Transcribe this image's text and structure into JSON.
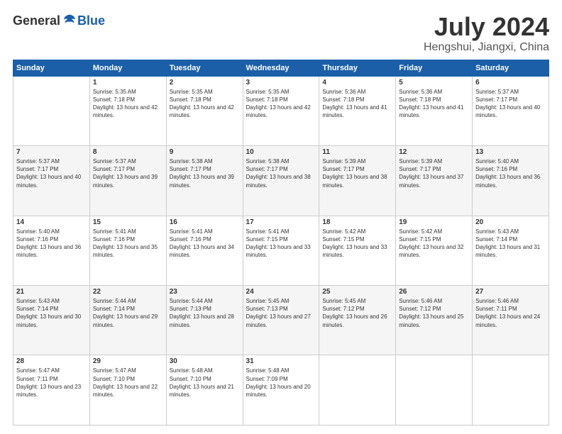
{
  "logo": {
    "general": "General",
    "blue": "Blue"
  },
  "header": {
    "title": "July 2024",
    "subtitle": "Hengshui, Jiangxi, China"
  },
  "weekdays": [
    "Sunday",
    "Monday",
    "Tuesday",
    "Wednesday",
    "Thursday",
    "Friday",
    "Saturday"
  ],
  "weeks": [
    [
      {
        "day": "",
        "sunrise": "",
        "sunset": "",
        "daylight": ""
      },
      {
        "day": "1",
        "sunrise": "Sunrise: 5:35 AM",
        "sunset": "Sunset: 7:18 PM",
        "daylight": "Daylight: 13 hours and 42 minutes."
      },
      {
        "day": "2",
        "sunrise": "Sunrise: 5:35 AM",
        "sunset": "Sunset: 7:18 PM",
        "daylight": "Daylight: 13 hours and 42 minutes."
      },
      {
        "day": "3",
        "sunrise": "Sunrise: 5:35 AM",
        "sunset": "Sunset: 7:18 PM",
        "daylight": "Daylight: 13 hours and 42 minutes."
      },
      {
        "day": "4",
        "sunrise": "Sunrise: 5:36 AM",
        "sunset": "Sunset: 7:18 PM",
        "daylight": "Daylight: 13 hours and 41 minutes."
      },
      {
        "day": "5",
        "sunrise": "Sunrise: 5:36 AM",
        "sunset": "Sunset: 7:18 PM",
        "daylight": "Daylight: 13 hours and 41 minutes."
      },
      {
        "day": "6",
        "sunrise": "Sunrise: 5:37 AM",
        "sunset": "Sunset: 7:17 PM",
        "daylight": "Daylight: 13 hours and 40 minutes."
      }
    ],
    [
      {
        "day": "7",
        "sunrise": "Sunrise: 5:37 AM",
        "sunset": "Sunset: 7:17 PM",
        "daylight": "Daylight: 13 hours and 40 minutes."
      },
      {
        "day": "8",
        "sunrise": "Sunrise: 5:37 AM",
        "sunset": "Sunset: 7:17 PM",
        "daylight": "Daylight: 13 hours and 39 minutes."
      },
      {
        "day": "9",
        "sunrise": "Sunrise: 5:38 AM",
        "sunset": "Sunset: 7:17 PM",
        "daylight": "Daylight: 13 hours and 39 minutes."
      },
      {
        "day": "10",
        "sunrise": "Sunrise: 5:38 AM",
        "sunset": "Sunset: 7:17 PM",
        "daylight": "Daylight: 13 hours and 38 minutes."
      },
      {
        "day": "11",
        "sunrise": "Sunrise: 5:39 AM",
        "sunset": "Sunset: 7:17 PM",
        "daylight": "Daylight: 13 hours and 38 minutes."
      },
      {
        "day": "12",
        "sunrise": "Sunrise: 5:39 AM",
        "sunset": "Sunset: 7:17 PM",
        "daylight": "Daylight: 13 hours and 37 minutes."
      },
      {
        "day": "13",
        "sunrise": "Sunrise: 5:40 AM",
        "sunset": "Sunset: 7:16 PM",
        "daylight": "Daylight: 13 hours and 36 minutes."
      }
    ],
    [
      {
        "day": "14",
        "sunrise": "Sunrise: 5:40 AM",
        "sunset": "Sunset: 7:16 PM",
        "daylight": "Daylight: 13 hours and 36 minutes."
      },
      {
        "day": "15",
        "sunrise": "Sunrise: 5:41 AM",
        "sunset": "Sunset: 7:16 PM",
        "daylight": "Daylight: 13 hours and 35 minutes."
      },
      {
        "day": "16",
        "sunrise": "Sunrise: 5:41 AM",
        "sunset": "Sunset: 7:16 PM",
        "daylight": "Daylight: 13 hours and 34 minutes."
      },
      {
        "day": "17",
        "sunrise": "Sunrise: 5:41 AM",
        "sunset": "Sunset: 7:15 PM",
        "daylight": "Daylight: 13 hours and 33 minutes."
      },
      {
        "day": "18",
        "sunrise": "Sunrise: 5:42 AM",
        "sunset": "Sunset: 7:15 PM",
        "daylight": "Daylight: 13 hours and 33 minutes."
      },
      {
        "day": "19",
        "sunrise": "Sunrise: 5:42 AM",
        "sunset": "Sunset: 7:15 PM",
        "daylight": "Daylight: 13 hours and 32 minutes."
      },
      {
        "day": "20",
        "sunrise": "Sunrise: 5:43 AM",
        "sunset": "Sunset: 7:14 PM",
        "daylight": "Daylight: 13 hours and 31 minutes."
      }
    ],
    [
      {
        "day": "21",
        "sunrise": "Sunrise: 5:43 AM",
        "sunset": "Sunset: 7:14 PM",
        "daylight": "Daylight: 13 hours and 30 minutes."
      },
      {
        "day": "22",
        "sunrise": "Sunrise: 5:44 AM",
        "sunset": "Sunset: 7:14 PM",
        "daylight": "Daylight: 13 hours and 29 minutes."
      },
      {
        "day": "23",
        "sunrise": "Sunrise: 5:44 AM",
        "sunset": "Sunset: 7:13 PM",
        "daylight": "Daylight: 13 hours and 28 minutes."
      },
      {
        "day": "24",
        "sunrise": "Sunrise: 5:45 AM",
        "sunset": "Sunset: 7:13 PM",
        "daylight": "Daylight: 13 hours and 27 minutes."
      },
      {
        "day": "25",
        "sunrise": "Sunrise: 5:45 AM",
        "sunset": "Sunset: 7:12 PM",
        "daylight": "Daylight: 13 hours and 26 minutes."
      },
      {
        "day": "26",
        "sunrise": "Sunrise: 5:46 AM",
        "sunset": "Sunset: 7:12 PM",
        "daylight": "Daylight: 13 hours and 25 minutes."
      },
      {
        "day": "27",
        "sunrise": "Sunrise: 5:46 AM",
        "sunset": "Sunset: 7:11 PM",
        "daylight": "Daylight: 13 hours and 24 minutes."
      }
    ],
    [
      {
        "day": "28",
        "sunrise": "Sunrise: 5:47 AM",
        "sunset": "Sunset: 7:11 PM",
        "daylight": "Daylight: 13 hours and 23 minutes."
      },
      {
        "day": "29",
        "sunrise": "Sunrise: 5:47 AM",
        "sunset": "Sunset: 7:10 PM",
        "daylight": "Daylight: 13 hours and 22 minutes."
      },
      {
        "day": "30",
        "sunrise": "Sunrise: 5:48 AM",
        "sunset": "Sunset: 7:10 PM",
        "daylight": "Daylight: 13 hours and 21 minutes."
      },
      {
        "day": "31",
        "sunrise": "Sunrise: 5:48 AM",
        "sunset": "Sunset: 7:09 PM",
        "daylight": "Daylight: 13 hours and 20 minutes."
      },
      {
        "day": "",
        "sunrise": "",
        "sunset": "",
        "daylight": ""
      },
      {
        "day": "",
        "sunrise": "",
        "sunset": "",
        "daylight": ""
      },
      {
        "day": "",
        "sunrise": "",
        "sunset": "",
        "daylight": ""
      }
    ]
  ]
}
